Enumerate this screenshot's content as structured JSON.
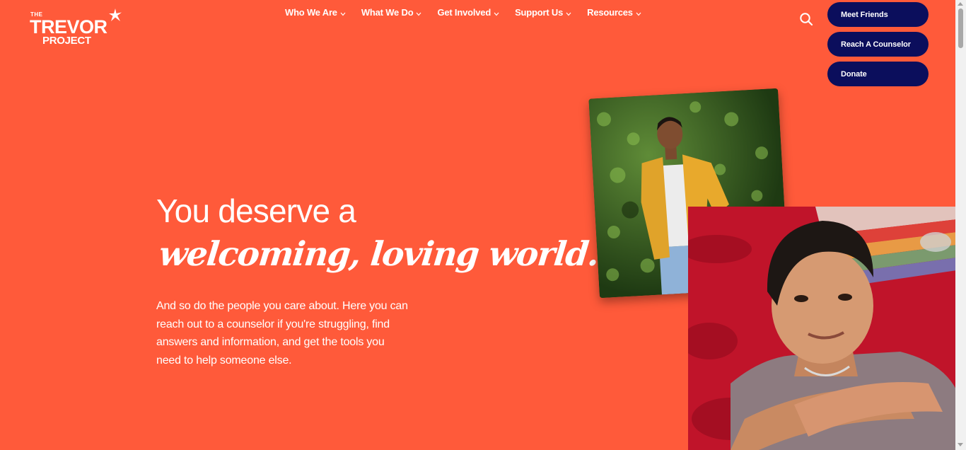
{
  "logo": {
    "the": "THE",
    "trevor": "TREVOR",
    "project": "PROJECT",
    "icon": "star-icon"
  },
  "nav": {
    "items": [
      {
        "label": "Who We Are",
        "icon": "chevron-down-icon"
      },
      {
        "label": "What We Do",
        "icon": "chevron-down-icon"
      },
      {
        "label": "Get Involved",
        "icon": "chevron-down-icon"
      },
      {
        "label": "Support Us",
        "icon": "chevron-down-icon"
      },
      {
        "label": "Resources",
        "icon": "chevron-down-icon"
      }
    ]
  },
  "search": {
    "icon": "search-icon"
  },
  "cta": {
    "meet_friends": "Meet Friends",
    "reach_counselor": "Reach A Counselor",
    "donate": "Donate"
  },
  "hero": {
    "headline": "You deserve a",
    "script": "welcoming, loving world.",
    "body": "And so do the people you care about. Here you can reach out to a counselor if you're struggling, find answers and information, and get the tools you need to help someone else."
  },
  "colors": {
    "background": "#ff5a3a",
    "button": "#0b0e5c",
    "text": "#ffffff"
  }
}
